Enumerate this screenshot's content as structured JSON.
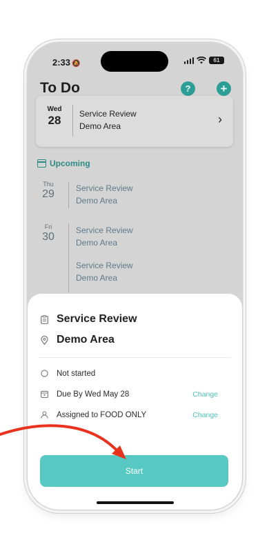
{
  "status_bar": {
    "time": "2:33",
    "battery": "61"
  },
  "header": {
    "title": "To Do"
  },
  "today": {
    "dow": "Wed",
    "day": "28",
    "task": "Service Review",
    "area": "Demo Area"
  },
  "upcoming": {
    "label": "Upcoming",
    "groups": [
      {
        "dow": "Thu",
        "day": "29",
        "items": [
          {
            "task": "Service Review",
            "area": "Demo Area"
          }
        ]
      },
      {
        "dow": "Fri",
        "day": "30",
        "items": [
          {
            "task": "Service Review",
            "area": "Demo Area"
          },
          {
            "task": "Service Review",
            "area": "Demo Area"
          }
        ]
      }
    ]
  },
  "sheet": {
    "task": "Service Review",
    "area": "Demo Area",
    "status": "Not started",
    "due": "Due By Wed May 28",
    "assigned": "Assigned to FOOD ONLY",
    "change_label": "Change",
    "start_label": "Start"
  },
  "colors": {
    "accent": "#2d9e95",
    "button": "#58c9c2",
    "link": "#4fc3bc",
    "annotation": "#e8321e"
  }
}
